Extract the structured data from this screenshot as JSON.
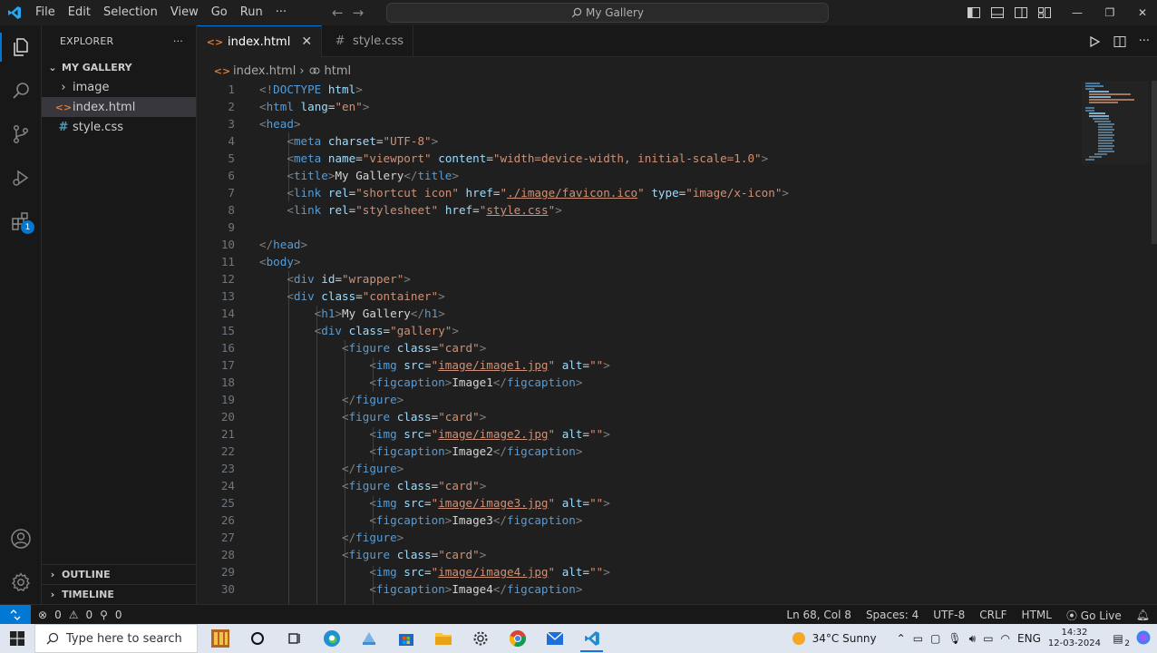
{
  "menu": {
    "items": [
      "File",
      "Edit",
      "Selection",
      "View",
      "Go",
      "Run",
      "···"
    ]
  },
  "command_center": {
    "text": "My Gallery"
  },
  "sidebar": {
    "title": "EXPLORER",
    "more": "···",
    "folder": "MY GALLERY",
    "items": [
      {
        "label": "image",
        "type": "folder"
      },
      {
        "label": "index.html",
        "type": "html"
      },
      {
        "label": "style.css",
        "type": "css"
      }
    ],
    "outline": "OUTLINE",
    "timeline": "TIMELINE"
  },
  "activity": {
    "extensions_badge": "1"
  },
  "tabs": [
    {
      "label": "index.html",
      "icon": "<>",
      "active": true,
      "close": "✕"
    },
    {
      "label": "style.css",
      "icon": "#",
      "active": false
    }
  ],
  "breadcrumb": {
    "file": "index.html",
    "symbol": "html"
  },
  "code": {
    "line_numbers": [
      "1",
      "2",
      "3",
      "4",
      "5",
      "6",
      "7",
      "8",
      "9",
      "10",
      "11",
      "12",
      "13",
      "14",
      "15",
      "16",
      "17",
      "18",
      "19",
      "20",
      "21",
      "22",
      "23",
      "24",
      "25",
      "26",
      "27",
      "28",
      "29",
      "30"
    ]
  },
  "statusbar": {
    "errors": "0",
    "warnings": "0",
    "ports": "0",
    "position": "Ln 68, Col 8",
    "spaces": "Spaces: 4",
    "encoding": "UTF-8",
    "eol": "CRLF",
    "language": "HTML",
    "golive": "Go Live"
  },
  "taskbar": {
    "search_placeholder": "Type here to search",
    "weather": "34°C  Sunny",
    "lang": "ENG",
    "time": "14:32",
    "date": "12-03-2024",
    "notifications": "2"
  },
  "colors": {
    "accent": "#0078d4",
    "tag": "#569cd6",
    "attr": "#9cdcfe",
    "string": "#ce9178",
    "bracket": "#808080"
  }
}
